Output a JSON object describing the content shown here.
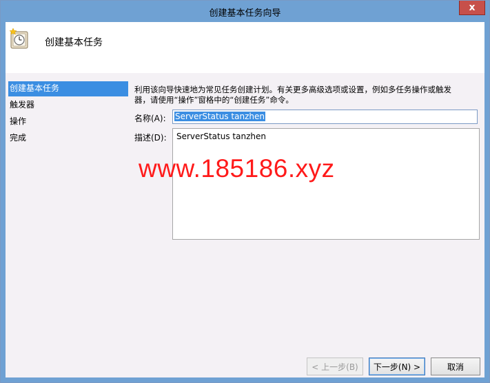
{
  "window": {
    "title": "创建基本任务向导",
    "close_label": "x"
  },
  "header": {
    "title": "创建基本任务",
    "icon": "clock-task-icon"
  },
  "nav": {
    "items": [
      {
        "label": "创建基本任务",
        "active": true
      },
      {
        "label": "触发器",
        "active": false
      },
      {
        "label": "操作",
        "active": false
      },
      {
        "label": "完成",
        "active": false
      }
    ]
  },
  "content": {
    "description_line1": "利用该向导快速地为常见任务创建计划。有关更多高级选项或设置，例如多任务操作或触发",
    "description_line2": "器，请使用“操作”窗格中的“创建任务”命令。",
    "name_label": "名称(A):",
    "name_value": "ServerStatus tanzhen",
    "desc_label": "描述(D):",
    "desc_value": "ServerStatus tanzhen"
  },
  "watermark": "www.185186.xyz",
  "buttons": {
    "back": "< 上一步(B)",
    "next": "下一步(N) >",
    "cancel": "取消"
  },
  "colors": {
    "titlebar": "#6fa1d3",
    "selection": "#3b8ee2",
    "watermark": "#ff1a1a",
    "close": "#c7504a"
  }
}
